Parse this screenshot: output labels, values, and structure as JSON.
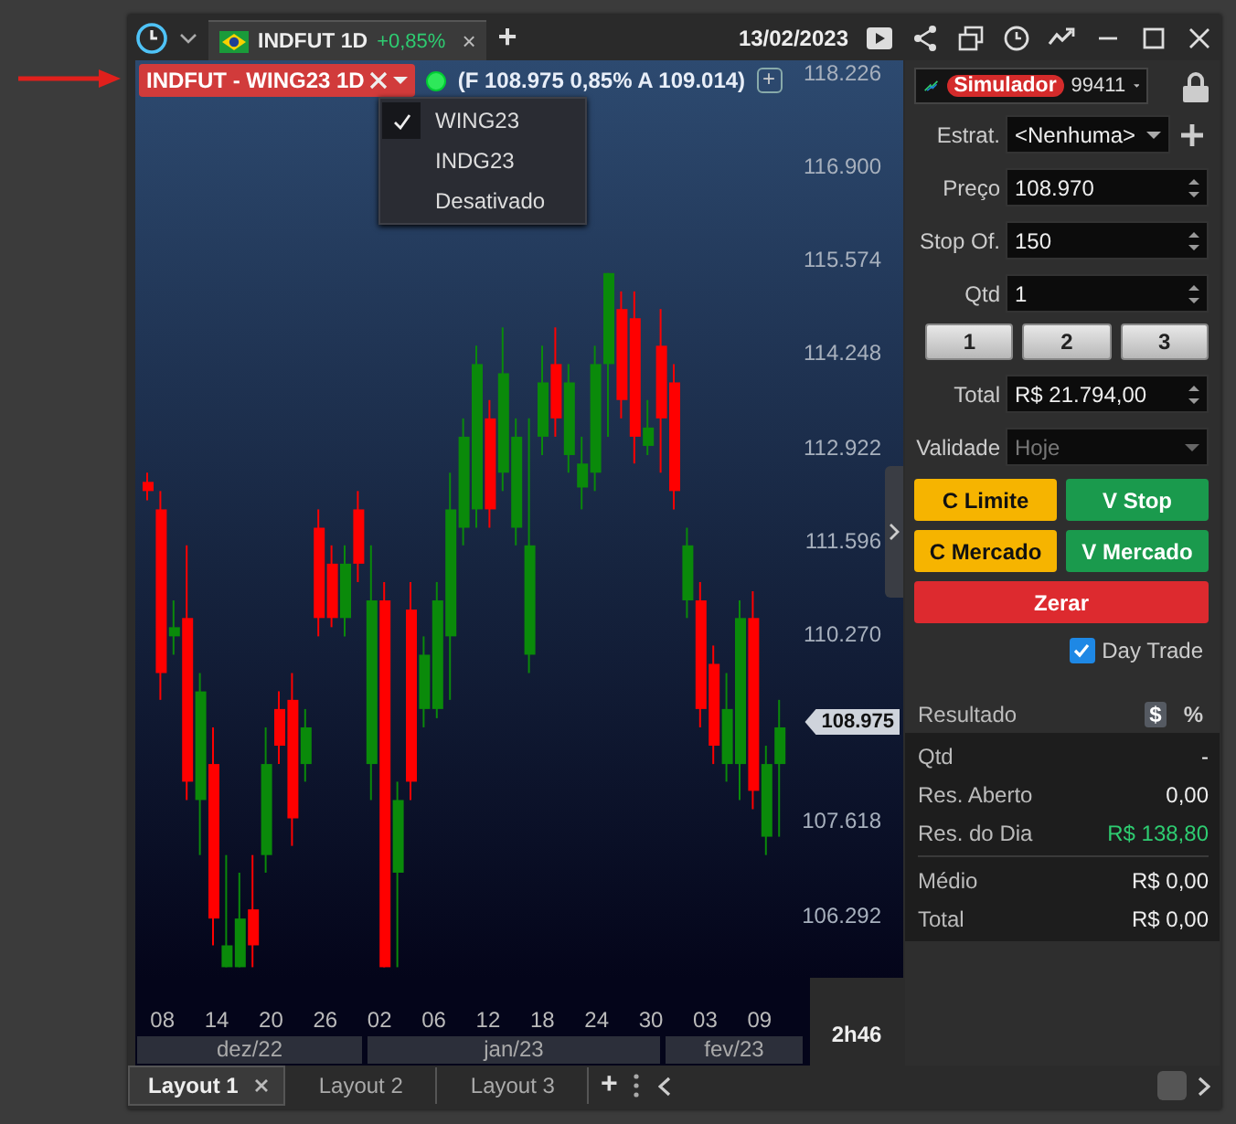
{
  "title_bar": {
    "tab": {
      "symbol": "INDFUT 1D",
      "change": "+0,85%",
      "close": "×"
    },
    "new_tab": "+",
    "date": "13/02/2023"
  },
  "chart": {
    "symbol_badge": "INDFUT - WING23 1D",
    "connected": true,
    "quote": "(F 108.975 0,85% A 109.014)",
    "add": "+",
    "menu": [
      {
        "label": "WING23",
        "checked": true
      },
      {
        "label": "INDG23",
        "checked": false
      },
      {
        "label": "Desativado",
        "checked": false
      }
    ],
    "chart_data": {
      "type": "candlestick",
      "ohlc": [
        [
          112430,
          112560,
          112170,
          112300
        ],
        [
          112040,
          112300,
          109340,
          109720
        ],
        [
          110240,
          110750,
          109980,
          110370
        ],
        [
          110500,
          111530,
          107920,
          108180
        ],
        [
          107920,
          109720,
          107140,
          109460
        ],
        [
          108430,
          108950,
          105860,
          106240
        ],
        [
          105550,
          107140,
          105550,
          105860
        ],
        [
          105550,
          106890,
          105550,
          106240
        ],
        [
          106370,
          107140,
          105550,
          105860
        ],
        [
          107140,
          108950,
          106890,
          108430
        ],
        [
          109210,
          109460,
          108430,
          108690
        ],
        [
          109340,
          109720,
          107270,
          107660
        ],
        [
          108430,
          109210,
          108180,
          108950
        ],
        [
          111780,
          112040,
          110240,
          110500
        ],
        [
          111270,
          111530,
          110370,
          110500
        ],
        [
          110500,
          111530,
          110240,
          111270
        ],
        [
          112040,
          112300,
          111010,
          111270
        ],
        [
          108430,
          111530,
          107920,
          110750
        ],
        [
          110750,
          111010,
          105550,
          105550
        ],
        [
          106890,
          108180,
          105550,
          107920
        ],
        [
          110620,
          111010,
          107920,
          108180
        ],
        [
          109210,
          110240,
          108950,
          109980
        ],
        [
          109210,
          111010,
          109080,
          110750
        ],
        [
          110240,
          112560,
          109340,
          112040
        ],
        [
          111780,
          113330,
          111530,
          113070
        ],
        [
          112040,
          114360,
          111780,
          114100
        ],
        [
          113330,
          113590,
          111780,
          112040
        ],
        [
          112560,
          114620,
          112300,
          113970
        ],
        [
          111780,
          113330,
          111530,
          113070
        ],
        [
          109980,
          113330,
          109720,
          111530
        ],
        [
          113070,
          114360,
          112810,
          113840
        ],
        [
          114100,
          114620,
          113070,
          113330
        ],
        [
          112810,
          114100,
          112560,
          113840
        ],
        [
          112350,
          113070,
          112040,
          112690
        ],
        [
          112560,
          114360,
          112300,
          114100
        ],
        [
          114100,
          115390,
          113070,
          115390
        ],
        [
          114880,
          115130,
          113330,
          113590
        ],
        [
          114750,
          115130,
          112690,
          113070
        ],
        [
          112940,
          113590,
          112810,
          113200
        ],
        [
          114360,
          114880,
          112560,
          113330
        ],
        [
          113840,
          114100,
          112040,
          112300
        ],
        [
          110750,
          111780,
          110500,
          111530
        ],
        [
          110750,
          111010,
          108950,
          109210
        ],
        [
          109850,
          110110,
          108430,
          108690
        ],
        [
          108430,
          109720,
          108180,
          109210
        ],
        [
          108430,
          110750,
          107920,
          110500
        ],
        [
          110500,
          110880,
          107790,
          108050
        ],
        [
          107400,
          108690,
          107140,
          108430
        ],
        [
          108430,
          109340,
          107400,
          108950
        ]
      ],
      "ylim": [
        105400,
        118406
      ],
      "yticks": [
        {
          "value": 118226,
          "label": "118.226"
        },
        {
          "value": 116900,
          "label": "116.900"
        },
        {
          "value": 115574,
          "label": "115.574"
        },
        {
          "value": 114248,
          "label": "114.248"
        },
        {
          "value": 112922,
          "label": "112.922"
        },
        {
          "value": 111596,
          "label": "111.596"
        },
        {
          "value": 110270,
          "label": "110.270"
        },
        {
          "value": 107618,
          "label": "107.618"
        },
        {
          "value": 106292,
          "label": "106.292"
        }
      ]
    },
    "last_price": "108.975",
    "days": [
      "08",
      "14",
      "20",
      "26",
      "02",
      "06",
      "12",
      "18",
      "24",
      "30",
      "03",
      "09"
    ],
    "months": [
      "dez/22",
      "jan/23",
      "fev/23"
    ],
    "countdown": "2h46"
  },
  "order_panel": {
    "account_badge": "Simulador",
    "account": "99411",
    "fields": [
      {
        "label": "Estrat.",
        "value": "<Nenhuma>",
        "kind": "dropdown",
        "disabled": false
      },
      {
        "label": "Preço",
        "value": "108.970",
        "kind": "spin",
        "disabled": false
      },
      {
        "label": "Stop Of.",
        "value": "150",
        "kind": "spin",
        "disabled": false
      }
    ],
    "qty": {
      "label": "Qtd",
      "value": "1"
    },
    "quick_qty": [
      "1",
      "2",
      "3"
    ],
    "bottom_fields": [
      {
        "label": "Total",
        "value": "R$ 21.794,00",
        "kind": "spin",
        "disabled": false
      },
      {
        "label": "Validade",
        "value": "Hoje",
        "kind": "dropdown",
        "disabled": true
      }
    ],
    "actions": [
      {
        "label": "C Limite",
        "kind": "buy"
      },
      {
        "label": "V Stop",
        "kind": "sell"
      },
      {
        "label": "C Mercado",
        "kind": "buy"
      },
      {
        "label": "V Mercado",
        "kind": "sell"
      },
      {
        "label": "Zerar",
        "kind": "zero"
      }
    ],
    "day_trade": {
      "label": "Day Trade",
      "checked": true
    },
    "result": {
      "title": "Resultado",
      "modes": [
        {
          "label": "$",
          "selected": true
        },
        {
          "label": "%",
          "selected": false
        }
      ],
      "rows": [
        {
          "label": "Qtd",
          "value": "-",
          "positive": false
        },
        {
          "label": "Res. Aberto",
          "value": "0,00",
          "positive": false
        },
        {
          "label": "Res. do Dia",
          "value": "R$ 138,80",
          "positive": true
        }
      ],
      "totals": [
        {
          "label": "Médio",
          "value": "R$ 0,00"
        },
        {
          "label": "Total",
          "value": "R$ 0,00"
        }
      ]
    }
  },
  "layout_tabs": [
    {
      "label": "Layout 1",
      "selected": true,
      "closable": true
    },
    {
      "label": "Layout 2",
      "selected": false,
      "closable": false
    },
    {
      "label": "Layout 3",
      "selected": false,
      "closable": false
    }
  ],
  "layout_add": "+"
}
